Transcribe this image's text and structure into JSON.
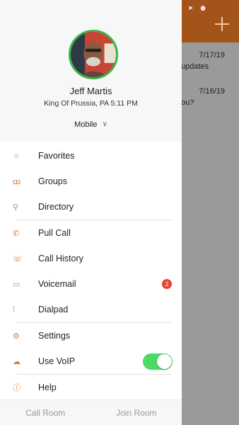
{
  "background": {
    "status_icons": "➤ ⏰",
    "rows": [
      {
        "date": "7/17/19",
        "snippet": "updates"
      },
      {
        "date": "7/16/19",
        "snippet": "ou?"
      }
    ]
  },
  "profile": {
    "name": "Jeff Martis",
    "location": "King Of Prussia, PA 5:11 PM",
    "device": "Mobile",
    "chevron": "∨"
  },
  "menu": {
    "favorites": {
      "label": "Favorites",
      "icon": "star-icon"
    },
    "groups": {
      "label": "Groups",
      "icon": "groups-icon"
    },
    "directory": {
      "label": "Directory",
      "icon": "search-icon"
    },
    "pull_call": {
      "label": "Pull Call",
      "icon": "phone-pull-icon"
    },
    "call_history": {
      "label": "Call History",
      "icon": "call-history-icon"
    },
    "voicemail": {
      "label": "Voicemail",
      "icon": "voicemail-icon",
      "badge": "2"
    },
    "dialpad": {
      "label": "Dialpad",
      "icon": "dialpad-icon"
    },
    "settings": {
      "label": "Settings",
      "icon": "gear-icon"
    },
    "use_voip": {
      "label": "Use VoIP",
      "icon": "cloud-icon",
      "enabled": true
    },
    "help": {
      "label": "Help",
      "icon": "help-icon"
    }
  },
  "footer": {
    "call_room": "Call Room",
    "join_room": "Join Room"
  },
  "colors": {
    "accent": "#e0782c",
    "header": "#a35418",
    "toggle_on": "#4cd964",
    "badge": "#e8412f",
    "avatar_ring": "#39b54a"
  }
}
